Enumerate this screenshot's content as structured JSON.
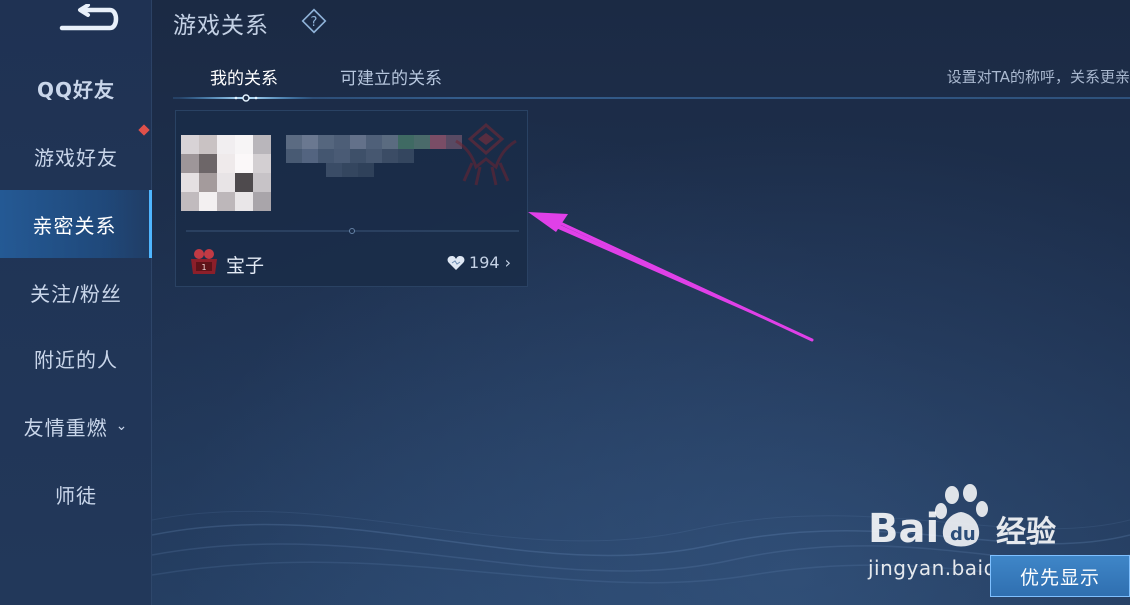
{
  "header": {
    "title": "游戏关系",
    "help_icon": "question-diamond-icon"
  },
  "sidebar": {
    "back_icon": "back-arrow-icon",
    "items": [
      {
        "label": "QQ好友",
        "active": false
      },
      {
        "label": "游戏好友",
        "active": false,
        "badge": "red-dot"
      },
      {
        "label": "亲密关系",
        "active": true
      },
      {
        "label": "关注/粉丝",
        "active": false
      },
      {
        "label": "附近的人",
        "active": false
      },
      {
        "label": "友情重燃",
        "active": false,
        "expand_icon": "chevron-down-icon"
      },
      {
        "label": "师徒",
        "active": false
      }
    ]
  },
  "tabs": [
    {
      "label": "我的关系",
      "selected": true
    },
    {
      "label": "可建立的关系",
      "selected": false
    }
  ],
  "hint": "设置对TA的称呼，关系更亲",
  "relation_card": {
    "relation_name": "宝子",
    "relation_level": "1",
    "intimacy_value": "194"
  },
  "footer": {
    "priority_label": "优先显示"
  },
  "watermark": {
    "brand": "Bai经验",
    "url": "jingyan.baidu.com"
  },
  "colors": {
    "background": "#1c2d47",
    "sidebar_active": "#2a78c8",
    "accent": "#4fb6ff",
    "annotation_arrow": "#e040e8",
    "badge_red": "#e0504a"
  }
}
